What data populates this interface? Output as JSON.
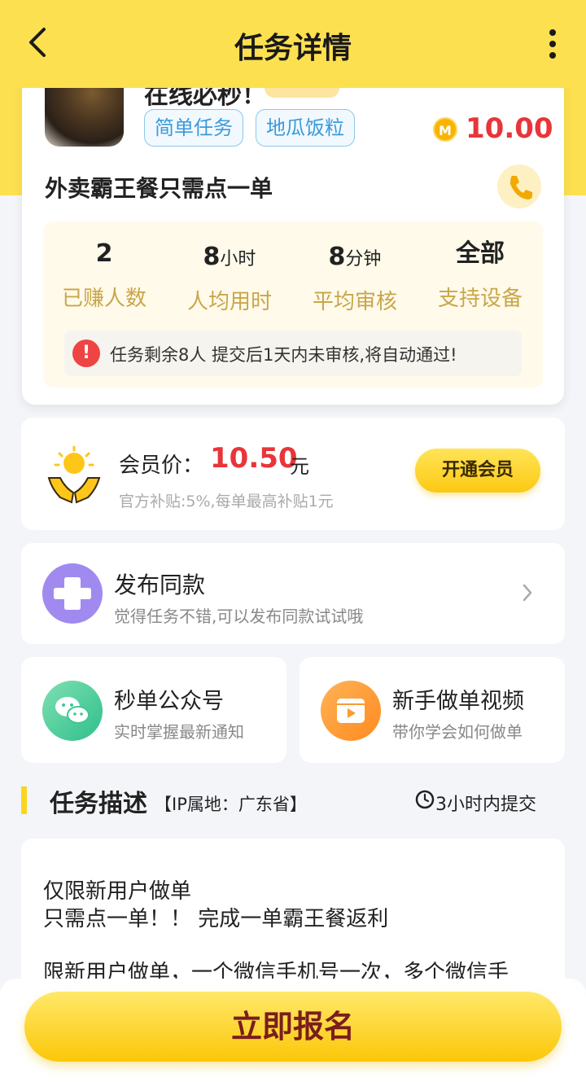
{
  "nav": {
    "title": "任务详情"
  },
  "task": {
    "partial_title": "在线必秒！",
    "tags": [
      "简单任务",
      "地瓜饭粒"
    ],
    "coin_symbol": "M",
    "price": "10.00",
    "name": "外卖霸王餐只需点一单",
    "stats": [
      {
        "num": "2",
        "unit": "",
        "label": "已赚人数"
      },
      {
        "num": "8",
        "unit": "小时",
        "label": "人均用时"
      },
      {
        "num": "8",
        "unit": "分钟",
        "label": "平均审核"
      },
      {
        "num": "全部",
        "unit": "",
        "label": "支持设备"
      }
    ],
    "notice_icon": "!",
    "notice": "任务剩余8人  提交后1天内未审核,将自动通过!"
  },
  "member": {
    "label": "会员价：",
    "price": "10.50",
    "unit": "元",
    "subsidy": "官方补贴:5%,每单最高补贴1元",
    "button": "开通会员"
  },
  "publish": {
    "title": "发布同款",
    "subtitle": "觉得任务不错,可以发布同款试试哦"
  },
  "wechat": {
    "title": "秒单公众号",
    "subtitle": "实时掌握最新通知"
  },
  "video": {
    "title": "新手做单视频",
    "subtitle": "带你学会如何做单"
  },
  "description": {
    "heading": "任务描述",
    "ip": "【IP属地：广东省】",
    "deadline": "3小时内提交",
    "lines": [
      "仅限新用户做单",
      "只需点一单！！ 完成一单霸王餐返利",
      "",
      "限新用户做单，一个微信手机号一次，多个微信手"
    ]
  },
  "cta": {
    "label": "立即报名"
  },
  "colors": {
    "brand_yellow": "#fde050",
    "price_red": "#e8353a",
    "tag_blue": "#3a9ad9"
  }
}
